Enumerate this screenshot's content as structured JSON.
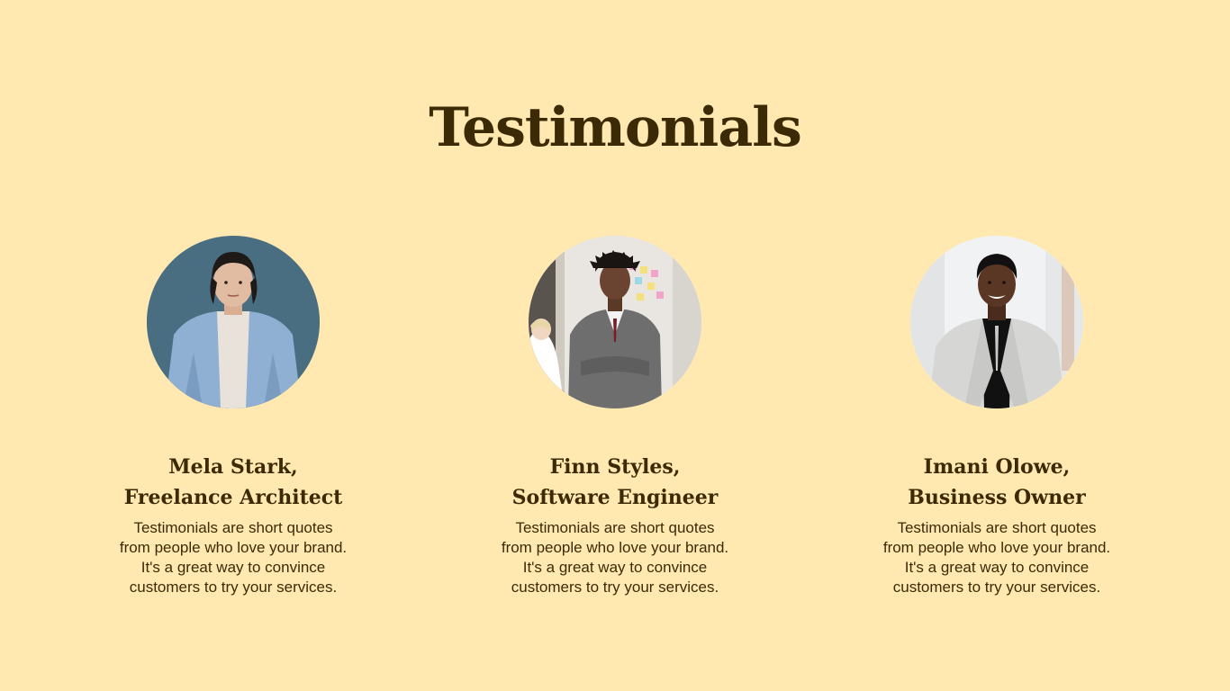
{
  "title": "Testimonials",
  "testimonials": [
    {
      "name": "Mela Stark,",
      "role": "Freelance Architect",
      "quote_lines": [
        "Testimonials are short quotes",
        "from people who love your brand.",
        "It's a great way to convince",
        "customers to try your services."
      ],
      "photo": "woman-denim-shirt-portrait"
    },
    {
      "name": "Finn Styles,",
      "role": "Software Engineer",
      "quote_lines": [
        "Testimonials are short quotes",
        "from people who love your brand.",
        "It's a great way to convince",
        "customers to try your services."
      ],
      "photo": "man-grey-suit-office-portrait"
    },
    {
      "name": "Imani Olowe,",
      "role": "Business Owner",
      "quote_lines": [
        "Testimonials are short quotes",
        "from people who love your brand.",
        "It's a great way to convince",
        "customers to try your services."
      ],
      "photo": "woman-blazer-smiling-portrait"
    }
  ],
  "colors": {
    "background": "#FFE9B1",
    "text": "#3C2A06"
  }
}
